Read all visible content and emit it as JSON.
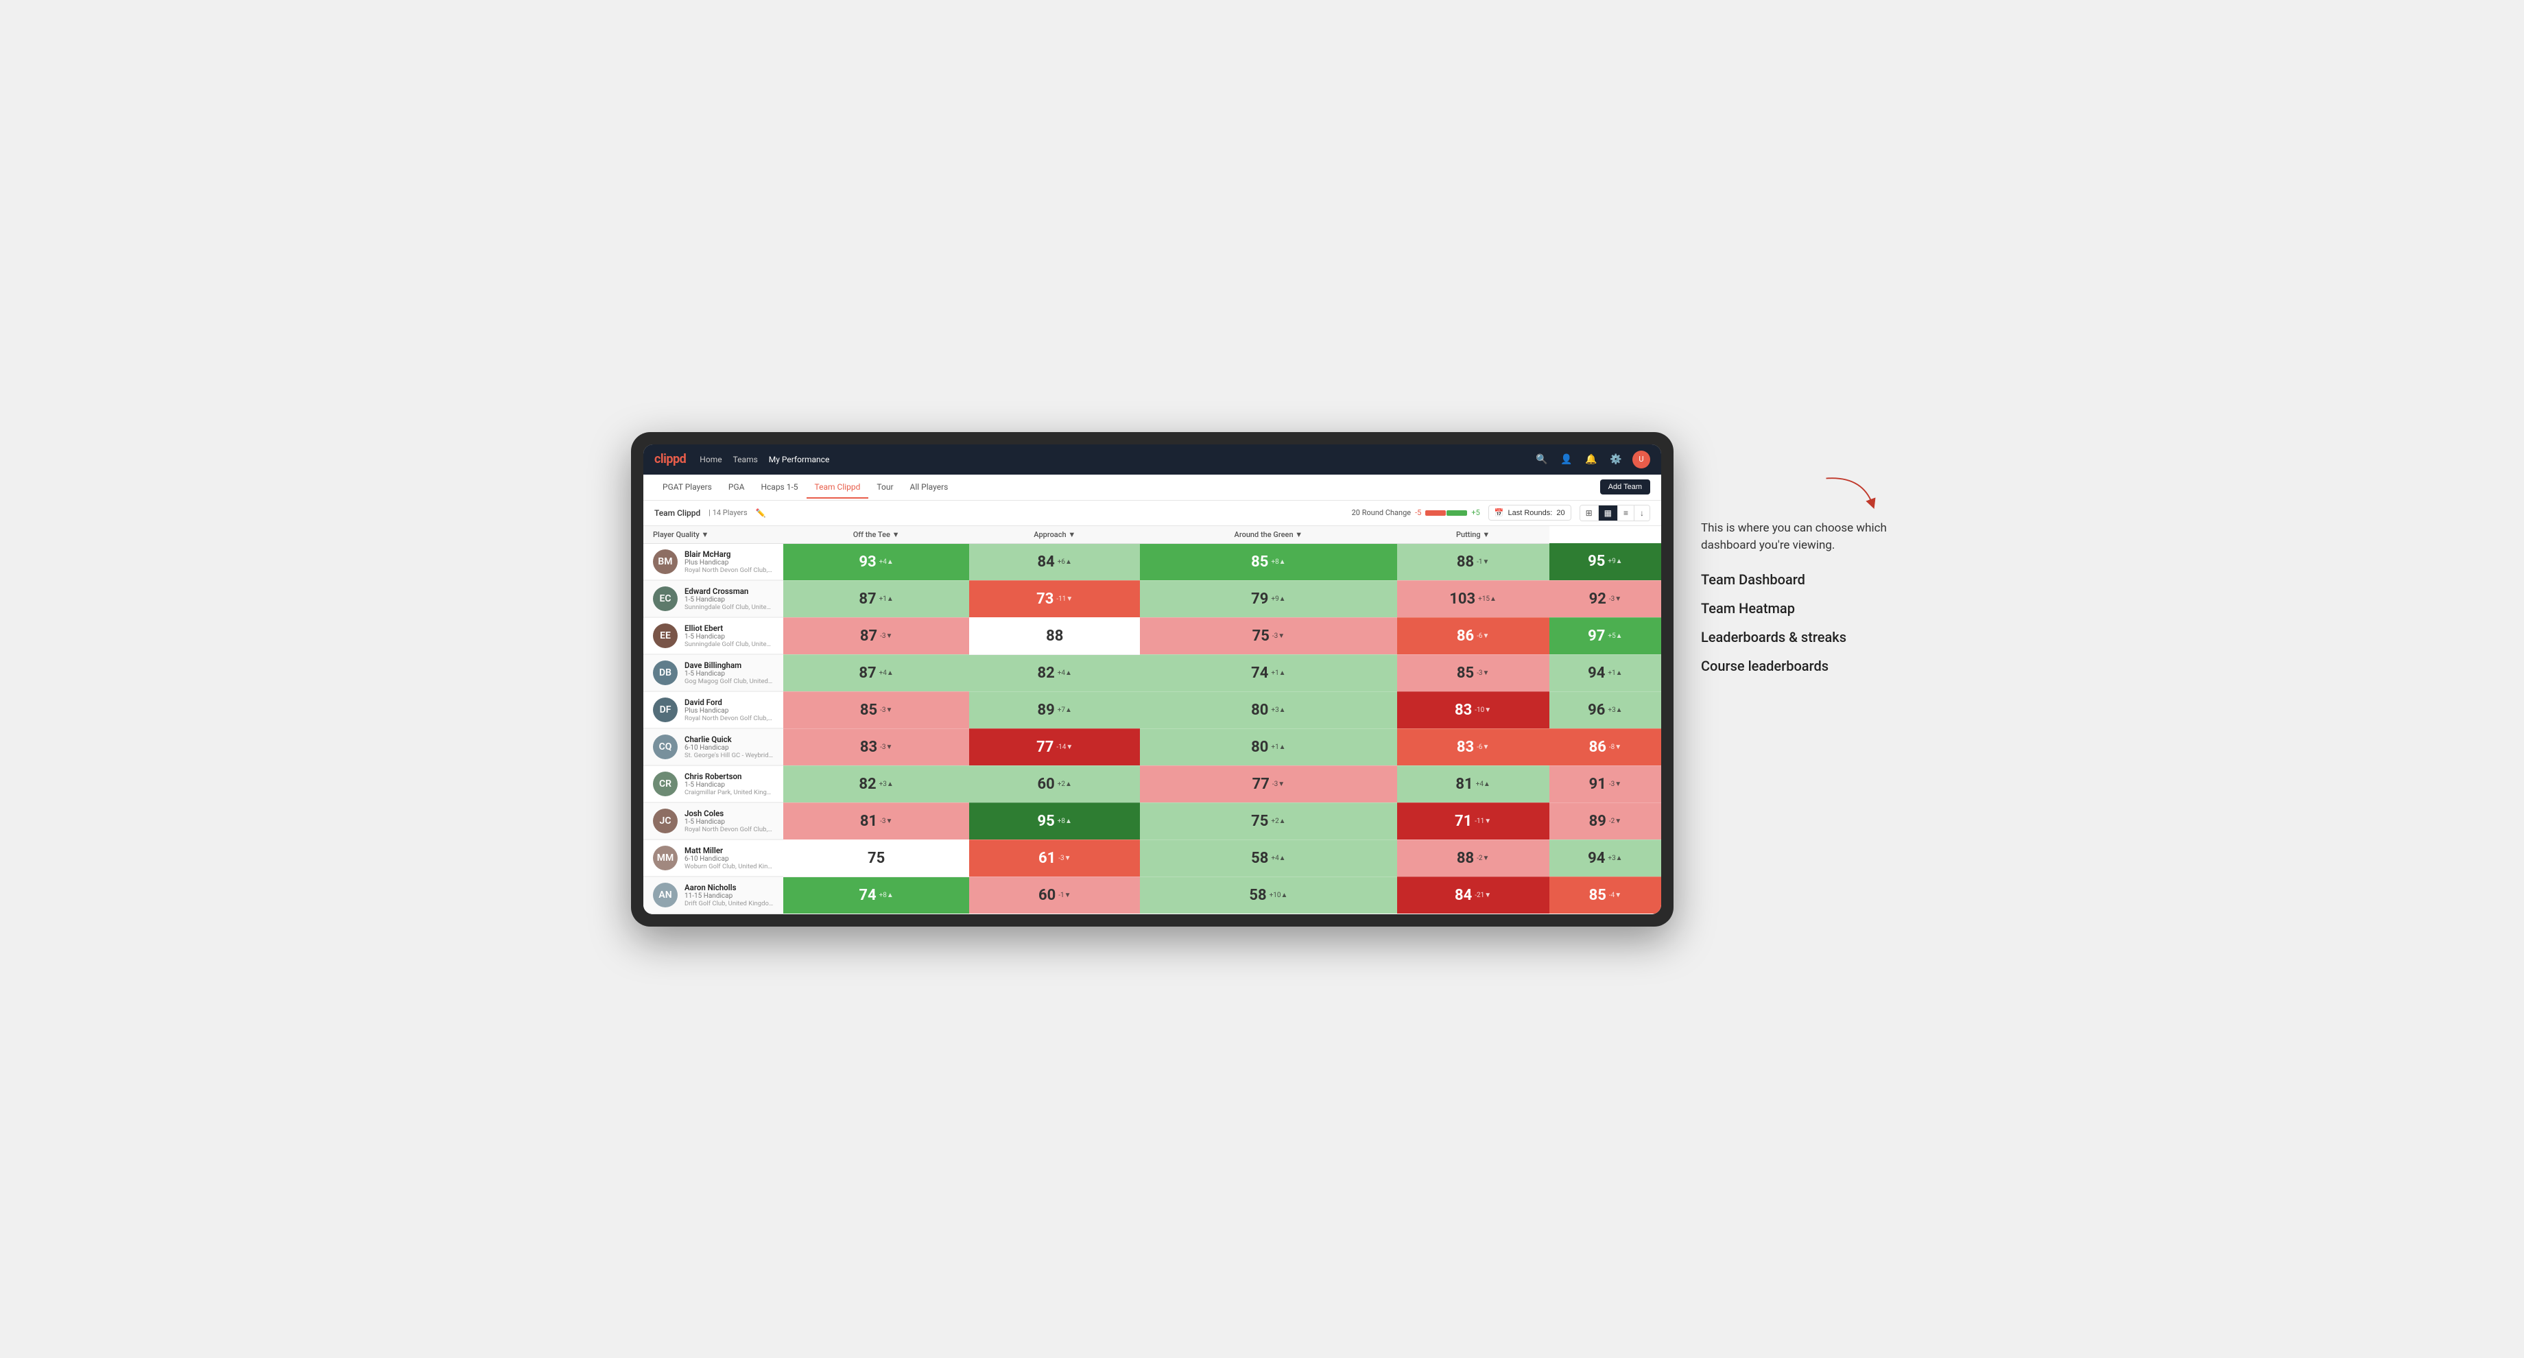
{
  "annotation": {
    "intro": "This is where you can choose which dashboard you're viewing.",
    "options": [
      "Team Dashboard",
      "Team Heatmap",
      "Leaderboards & streaks",
      "Course leaderboards"
    ]
  },
  "topNav": {
    "logo": "clippd",
    "links": [
      "Home",
      "Teams",
      "My Performance"
    ],
    "activeLink": "My Performance"
  },
  "subNav": {
    "links": [
      "PGAT Players",
      "PGA",
      "Hcaps 1-5",
      "Team Clippd",
      "Tour",
      "All Players"
    ],
    "activeLink": "Team Clippd",
    "addTeamLabel": "Add Team"
  },
  "teamHeader": {
    "name": "Team Clippd",
    "separator": "|",
    "count": "14 Players",
    "roundChangeLabel": "20 Round Change",
    "changeNeg": "-5",
    "changePos": "+5",
    "lastRoundsLabel": "Last Rounds:",
    "lastRoundsValue": "20"
  },
  "tableHeaders": {
    "playerQuality": "Player Quality ▼",
    "offTheTee": "Off the Tee ▼",
    "approach": "Approach ▼",
    "aroundTheGreen": "Around the Green ▼",
    "putting": "Putting ▼"
  },
  "players": [
    {
      "name": "Blair McHarg",
      "handicap": "Plus Handicap",
      "club": "Royal North Devon Golf Club, United Kingdom",
      "avatarColor": "#8d6e63",
      "initials": "BM",
      "scores": {
        "playerQuality": {
          "value": 93,
          "change": "+4",
          "dir": "up",
          "bg": "green-mid"
        },
        "offTheTee": {
          "value": 84,
          "change": "+6",
          "dir": "up",
          "bg": "green-light"
        },
        "approach": {
          "value": 85,
          "change": "+8",
          "dir": "up",
          "bg": "green-mid"
        },
        "aroundTheGreen": {
          "value": 88,
          "change": "-1",
          "dir": "down",
          "bg": "green-light"
        },
        "putting": {
          "value": 95,
          "change": "+9",
          "dir": "up",
          "bg": "green-dark"
        }
      }
    },
    {
      "name": "Edward Crossman",
      "handicap": "1-5 Handicap",
      "club": "Sunningdale Golf Club, United Kingdom",
      "avatarColor": "#5d7a6b",
      "initials": "EC",
      "scores": {
        "playerQuality": {
          "value": 87,
          "change": "+1",
          "dir": "up",
          "bg": "green-light"
        },
        "offTheTee": {
          "value": 73,
          "change": "-11",
          "dir": "down",
          "bg": "red-mid"
        },
        "approach": {
          "value": 79,
          "change": "+9",
          "dir": "up",
          "bg": "green-light"
        },
        "aroundTheGreen": {
          "value": 103,
          "change": "+15",
          "dir": "up",
          "bg": "red-light"
        },
        "putting": {
          "value": 92,
          "change": "-3",
          "dir": "down",
          "bg": "red-light"
        }
      }
    },
    {
      "name": "Elliot Ebert",
      "handicap": "1-5 Handicap",
      "club": "Sunningdale Golf Club, United Kingdom",
      "avatarColor": "#795548",
      "initials": "EE",
      "scores": {
        "playerQuality": {
          "value": 87,
          "change": "-3",
          "dir": "down",
          "bg": "red-light"
        },
        "offTheTee": {
          "value": 88,
          "change": "",
          "dir": "",
          "bg": "white"
        },
        "approach": {
          "value": 75,
          "change": "-3",
          "dir": "down",
          "bg": "red-light"
        },
        "aroundTheGreen": {
          "value": 86,
          "change": "-6",
          "dir": "down",
          "bg": "red-mid"
        },
        "putting": {
          "value": 97,
          "change": "+5",
          "dir": "up",
          "bg": "green-mid"
        }
      }
    },
    {
      "name": "Dave Billingham",
      "handicap": "1-5 Handicap",
      "club": "Gog Magog Golf Club, United Kingdom",
      "avatarColor": "#607d8b",
      "initials": "DB",
      "scores": {
        "playerQuality": {
          "value": 87,
          "change": "+4",
          "dir": "up",
          "bg": "green-light"
        },
        "offTheTee": {
          "value": 82,
          "change": "+4",
          "dir": "up",
          "bg": "green-light"
        },
        "approach": {
          "value": 74,
          "change": "+1",
          "dir": "up",
          "bg": "green-light"
        },
        "aroundTheGreen": {
          "value": 85,
          "change": "-3",
          "dir": "down",
          "bg": "red-light"
        },
        "putting": {
          "value": 94,
          "change": "+1",
          "dir": "up",
          "bg": "green-light"
        }
      }
    },
    {
      "name": "David Ford",
      "handicap": "Plus Handicap",
      "club": "Royal North Devon Golf Club, United Kingdom",
      "avatarColor": "#546e7a",
      "initials": "DF",
      "scores": {
        "playerQuality": {
          "value": 85,
          "change": "-3",
          "dir": "down",
          "bg": "red-light"
        },
        "offTheTee": {
          "value": 89,
          "change": "+7",
          "dir": "up",
          "bg": "green-light"
        },
        "approach": {
          "value": 80,
          "change": "+3",
          "dir": "up",
          "bg": "green-light"
        },
        "aroundTheGreen": {
          "value": 83,
          "change": "-10",
          "dir": "down",
          "bg": "red-dark"
        },
        "putting": {
          "value": 96,
          "change": "+3",
          "dir": "up",
          "bg": "green-light"
        }
      }
    },
    {
      "name": "Charlie Quick",
      "handicap": "6-10 Handicap",
      "club": "St. George's Hill GC - Weybridge - Surrey, Uni...",
      "avatarColor": "#78909c",
      "initials": "CQ",
      "scores": {
        "playerQuality": {
          "value": 83,
          "change": "-3",
          "dir": "down",
          "bg": "red-light"
        },
        "offTheTee": {
          "value": 77,
          "change": "-14",
          "dir": "down",
          "bg": "red-dark"
        },
        "approach": {
          "value": 80,
          "change": "+1",
          "dir": "up",
          "bg": "green-light"
        },
        "aroundTheGreen": {
          "value": 83,
          "change": "-6",
          "dir": "down",
          "bg": "red-mid"
        },
        "putting": {
          "value": 86,
          "change": "-8",
          "dir": "down",
          "bg": "red-mid"
        }
      }
    },
    {
      "name": "Chris Robertson",
      "handicap": "1-5 Handicap",
      "club": "Craigmillar Park, United Kingdom",
      "avatarColor": "#6d8b74",
      "initials": "CR",
      "scores": {
        "playerQuality": {
          "value": 82,
          "change": "+3",
          "dir": "up",
          "bg": "green-light"
        },
        "offTheTee": {
          "value": 60,
          "change": "+2",
          "dir": "up",
          "bg": "green-light"
        },
        "approach": {
          "value": 77,
          "change": "-3",
          "dir": "down",
          "bg": "red-light"
        },
        "aroundTheGreen": {
          "value": 81,
          "change": "+4",
          "dir": "up",
          "bg": "green-light"
        },
        "putting": {
          "value": 91,
          "change": "-3",
          "dir": "down",
          "bg": "red-light"
        }
      }
    },
    {
      "name": "Josh Coles",
      "handicap": "1-5 Handicap",
      "club": "Royal North Devon Golf Club, United Kingdom",
      "avatarColor": "#8d6e63",
      "initials": "JC",
      "scores": {
        "playerQuality": {
          "value": 81,
          "change": "-3",
          "dir": "down",
          "bg": "red-light"
        },
        "offTheTee": {
          "value": 95,
          "change": "+8",
          "dir": "up",
          "bg": "green-dark"
        },
        "approach": {
          "value": 75,
          "change": "+2",
          "dir": "up",
          "bg": "green-light"
        },
        "aroundTheGreen": {
          "value": 71,
          "change": "-11",
          "dir": "down",
          "bg": "red-dark"
        },
        "putting": {
          "value": 89,
          "change": "-2",
          "dir": "down",
          "bg": "red-light"
        }
      }
    },
    {
      "name": "Matt Miller",
      "handicap": "6-10 Handicap",
      "club": "Woburn Golf Club, United Kingdom",
      "avatarColor": "#a1887f",
      "initials": "MM",
      "scores": {
        "playerQuality": {
          "value": 75,
          "change": "",
          "dir": "",
          "bg": "white"
        },
        "offTheTee": {
          "value": 61,
          "change": "-3",
          "dir": "down",
          "bg": "red-mid"
        },
        "approach": {
          "value": 58,
          "change": "+4",
          "dir": "up",
          "bg": "green-light"
        },
        "aroundTheGreen": {
          "value": 88,
          "change": "-2",
          "dir": "down",
          "bg": "red-light"
        },
        "putting": {
          "value": 94,
          "change": "+3",
          "dir": "up",
          "bg": "green-light"
        }
      }
    },
    {
      "name": "Aaron Nicholls",
      "handicap": "11-15 Handicap",
      "club": "Drift Golf Club, United Kingdom",
      "avatarColor": "#90a4ae",
      "initials": "AN",
      "scores": {
        "playerQuality": {
          "value": 74,
          "change": "+8",
          "dir": "up",
          "bg": "green-mid"
        },
        "offTheTee": {
          "value": 60,
          "change": "-1",
          "dir": "down",
          "bg": "red-light"
        },
        "approach": {
          "value": 58,
          "change": "+10",
          "dir": "up",
          "bg": "green-light"
        },
        "aroundTheGreen": {
          "value": 84,
          "change": "-21",
          "dir": "down",
          "bg": "red-dark"
        },
        "putting": {
          "value": 85,
          "change": "-4",
          "dir": "down",
          "bg": "red-mid"
        }
      }
    }
  ]
}
